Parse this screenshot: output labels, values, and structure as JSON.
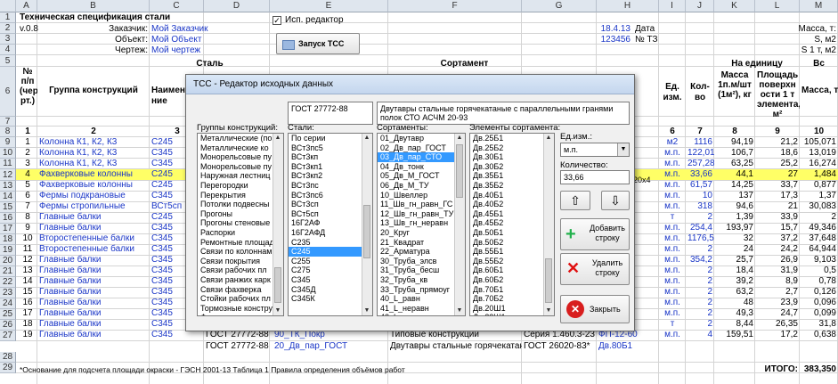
{
  "columns": [
    "A",
    "B",
    "C",
    "D",
    "E",
    "F",
    "G",
    "H",
    "I",
    "J",
    "K",
    "L",
    "M"
  ],
  "rows": [
    "1",
    "2",
    "3",
    "4",
    "5",
    "6",
    "7",
    "8",
    "9",
    "10",
    "11",
    "12",
    "13",
    "14",
    "15",
    "16",
    "17",
    "18",
    "19",
    "20",
    "21",
    "22",
    "23",
    "24",
    "25",
    "26",
    "27",
    "28",
    "29"
  ],
  "top": {
    "title": "Техническая спецификация стали",
    "version": "v.0.8",
    "customer_label": "Заказчик:",
    "customer": "Мой Заказчик",
    "object_label": "Объект:",
    "object": "Мой Объект",
    "drawing_label": "Чертеж:",
    "drawing": "Мой чертеж",
    "date_value": "18.4.13",
    "date_label": "Дата",
    "tz_value": "123456",
    "tz_label": "№ ТЗ",
    "mass_t": "Масса, т:",
    "s_m2": "S, м2",
    "s1": "S 1 т, м2",
    "checkbox_label": "Исп. редактор",
    "tss_button": "Запуск ТСС"
  },
  "header": {
    "num": "№ п/п (чер рт.)",
    "group": "Группа конструкций",
    "steel": "Сталь",
    "name_short": "Наимен ние",
    "sortament": "Сортамент",
    "ed_izm": "Ед. изм.",
    "kolvo": "Кол-во",
    "per_unit": "На единицу",
    "mass_1": "Масса 1п.м/шт (1м²), кг",
    "area": "Площадь поверхн ости 1 т элемента, м²",
    "mass_t": "Масса, т:",
    "vs": "Вс",
    "n1": "1",
    "n2": "2",
    "n3": "3",
    "n6": "6",
    "n7": "7",
    "n8": "8",
    "n9": "9",
    "n10": "10"
  },
  "table": [
    {
      "n": "1",
      "group": "Колонна К1, К2, К3",
      "steel": "С245",
      "unit": "м2",
      "qty": "1116",
      "m1": "94,19",
      "area": "21,2",
      "mass": "105,071"
    },
    {
      "n": "2",
      "group": "Колонна К1, К2, К3",
      "steel": "С345",
      "unit": "м.п.",
      "qty": "122,01",
      "m1": "106,7",
      "area": "18,6",
      "mass": "13,019"
    },
    {
      "n": "3",
      "group": "Колонна К1, К2, К3",
      "steel": "С345",
      "unit": "м.п.",
      "qty": "257,28",
      "m1": "63,25",
      "area": "25,2",
      "mass": "16,274"
    },
    {
      "n": "4",
      "group": "Фахверковые колонны",
      "steel": "С245",
      "unit": "м.п.",
      "qty": "33,66",
      "m1": "44,1",
      "area": "27",
      "mass": "1,484"
    },
    {
      "n": "5",
      "group": "Фахверковые колонны",
      "steel": "С245",
      "unit": "м.п.",
      "qty": "61,57",
      "m1": "14,25",
      "area": "33,7",
      "mass": "0,877"
    },
    {
      "n": "6",
      "group": "Фермы подкрановые",
      "steel": "С345",
      "unit": "м.п.",
      "qty": "10",
      "m1": "137",
      "area": "17,3",
      "mass": "1,37"
    },
    {
      "n": "7",
      "group": "Фермы стропильные",
      "steel": "ВСт5сп",
      "unit": "м.п.",
      "qty": "318",
      "m1": "94,6",
      "area": "21",
      "mass": "30,083"
    },
    {
      "n": "8",
      "group": "Главные балки",
      "steel": "С245",
      "unit": "т",
      "qty": "2",
      "m1": "1,39",
      "area": "33,9",
      "mass": "2"
    },
    {
      "n": "9",
      "group": "Главные балки",
      "steel": "С345",
      "unit": "м.п.",
      "qty": "254,4",
      "m1": "193,97",
      "area": "15,7",
      "mass": "49,346"
    },
    {
      "n": "10",
      "group": "Второстепенные балки",
      "steel": "С345",
      "unit": "м.п.",
      "qty": "1176,5",
      "m1": "32",
      "area": "37,2",
      "mass": "37,648"
    },
    {
      "n": "11",
      "group": "Второстепенные балки",
      "steel": "С345",
      "unit": "м.п.",
      "qty": "2",
      "m1": "24",
      "area": "24,2",
      "mass": "64,944"
    },
    {
      "n": "12",
      "group": "Главные балки",
      "steel": "С345",
      "unit": "м.п.",
      "qty": "354,2",
      "m1": "25,7",
      "area": "26,9",
      "mass": "9,103"
    },
    {
      "n": "13",
      "group": "Главные балки",
      "steel": "С345",
      "unit": "м.п.",
      "qty": "2",
      "m1": "18,4",
      "area": "31,9",
      "mass": "0,5"
    },
    {
      "n": "14",
      "group": "Главные балки",
      "steel": "С345",
      "unit": "м.п.",
      "qty": "2",
      "m1": "39,2",
      "area": "8,9",
      "mass": "0,78"
    },
    {
      "n": "15",
      "group": "Главные балки",
      "steel": "С345",
      "unit": "м.п.",
      "qty": "2",
      "m1": "63,2",
      "area": "2,7",
      "mass": "0,126"
    },
    {
      "n": "16",
      "group": "Главные балки",
      "steel": "С345",
      "unit": "м.п.",
      "qty": "2",
      "m1": "48",
      "area": "23,9",
      "mass": "0,096"
    },
    {
      "n": "17",
      "group": "Главные балки",
      "steel": "С345",
      "unit": "м.п.",
      "qty": "2",
      "m1": "49,3",
      "area": "24,7",
      "mass": "0,099"
    },
    {
      "n": "18",
      "group": "Главные балки",
      "steel": "С345",
      "unit": "т",
      "qty": "2",
      "m1": "8,44",
      "area": "26,35",
      "mass": "31,8"
    },
    {
      "n": "19",
      "group": "Главные балки",
      "steel": "С345",
      "unit": "м.п.",
      "qty": "4",
      "m1": "159,51",
      "area": "17,2",
      "mass": "0,638"
    }
  ],
  "row25": {
    "gost": "ГОСТ 27772-88",
    "el": "90_ТК_Покр",
    "sort": "Типовые конструкции",
    "seriya": "Серия 1.460.3-23 9",
    "prof": "ФП-12-60"
  },
  "row26": {
    "gost": "ГОСТ 27772-88",
    "el": "20_Дв_пар_ГОСТ",
    "sort": "Двутавры стальные горячекатаные с па",
    "gost2": "ГОСТ 26020-83*",
    "prof": "Дв.80Б1"
  },
  "footer": {
    "note": "*Основание для подсчета площади окраски - ГЭСН 2001-13 Таблица 1 Правила определения объёмов работ",
    "total_label": "ИТОГО:",
    "total_value": "383,350"
  },
  "dialog": {
    "title": "ТСС - Редактор исходных данных",
    "gost": "ГОСТ 27772-88",
    "description": "Двутавры стальные горячекатаные с параллельными гранями полок СТО АСЧМ 20-93",
    "groups_label": "Группы конструкций:",
    "steels_label": "Стали:",
    "sortaments_label": "Сортаменты:",
    "elements_label": "Элементы сортамента:",
    "unit_label": "Ед.изм.:",
    "unit_value": "м.п.",
    "qty_label": "Количество:",
    "qty_value": "33,66",
    "add_button": "Добавить строку",
    "delete_button": "Удалить строку",
    "close_button": "Закрыть",
    "groups": [
      "Металлические (по",
      "Металлические ко",
      "Монорельсовые пу",
      "Монорельсовые пу",
      "Наружная лестниц",
      "Перегородки",
      "Перекрытия",
      "Потолки подвесны",
      "Прогоны",
      "Прогоны стеновые",
      "Распорки",
      "Ремонтные площад",
      "Связи по колоннам",
      "Связи покрытия",
      "Связи рабочих пл",
      "Связи ранжих карк",
      "Связи фахверка",
      "Стойки рабочих пл",
      "Тормозные констру",
      "Фахверки",
      "Фахверковые коло"
    ],
    "steels": [
      "По серии",
      "ВСт3пс5",
      "ВСт3кп",
      "ВСт3кп1",
      "ВСт3кп2",
      "ВСт3пс",
      "ВСт3пс6",
      "ВСт3сп",
      "ВСт5сп",
      "16Г2АФ",
      "16Г2АФД",
      "С235",
      "С245",
      "С255",
      "С275",
      "С345",
      "С345Д",
      "С345К"
    ],
    "sortaments": [
      "01_Двутавр",
      "02_Дв_пар_ГОСТ",
      "03_Дв_пар_СТО",
      "04_Дв_тонк",
      "05_Дв_М_ГОСТ",
      "06_Дв_М_ТУ",
      "10_Швеллер",
      "11_Шв_гн_равн_ГС",
      "12_Шв_гн_равн_ТУ",
      "13_Шв_гн_неравн",
      "20_Круг",
      "21_Квадрат",
      "22_Арматура",
      "30_Труба_элсв",
      "31_Труба_бесш",
      "32_Труба_кв",
      "33_Труба_прямоуг",
      "40_L_равн",
      "41_L_неравн",
      "42_L_равн_гн",
      "43_L_равн_гн_"
    ],
    "elements": [
      "Дв.25Б1",
      "Дв.25Б2",
      "Дв.30Б1",
      "Дв.30Б2",
      "Дв.35Б1",
      "Дв.35Б2",
      "Дв.40Б1",
      "Дв.40Б2",
      "Дв.45Б1",
      "Дв.45Б2",
      "Дв.50Б1",
      "Дв.50Б2",
      "Дв.55Б1",
      "Дв.55Б2",
      "Дв.60Б1",
      "Дв.60Б2",
      "Дв.70Б1",
      "Дв.70Б2",
      "Дв.20Ш1",
      "Дв.23Ш1",
      "Дв.26Ш1"
    ]
  },
  "partial": {
    "cell_20x4": "20х4"
  }
}
